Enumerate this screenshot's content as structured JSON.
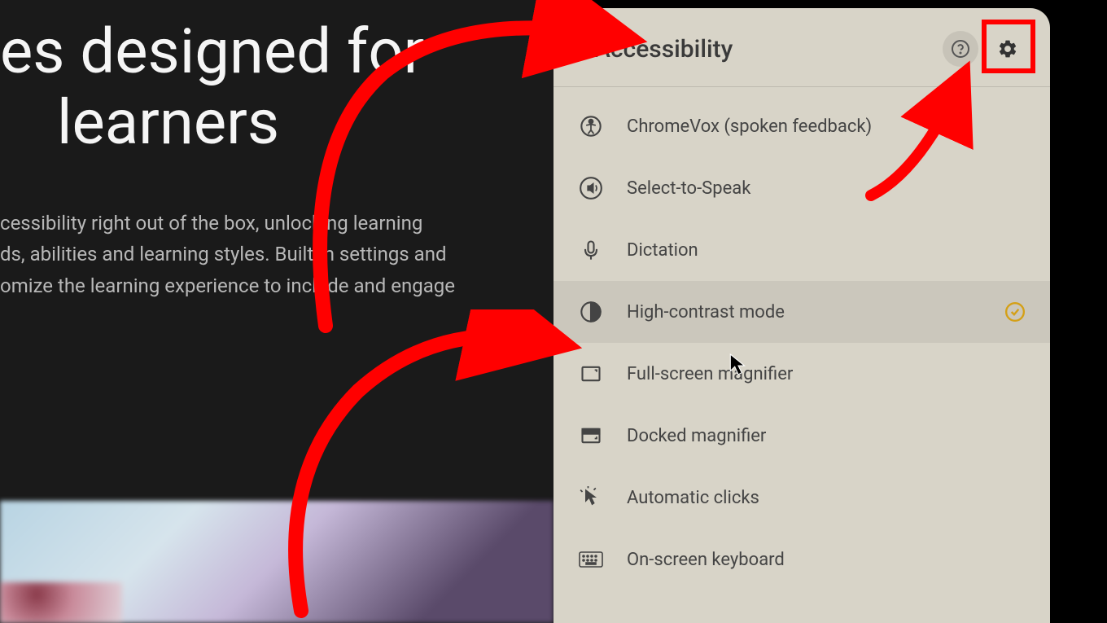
{
  "background": {
    "heading_line1": "es designed for",
    "heading_line2": "learners",
    "body": "cessibility right out of the box, unlocking learning\nds, abilities and learning styles. Built-in settings and\nomize the learning experience to include and engage"
  },
  "panel": {
    "title": "Accessibility",
    "items": [
      {
        "id": "chromevox",
        "label": "ChromeVox (spoken feedback)",
        "icon": "accessibility-icon",
        "highlighted": false,
        "checked": false
      },
      {
        "id": "select-to-speak",
        "label": "Select-to-Speak",
        "icon": "speak-icon",
        "highlighted": false,
        "checked": false
      },
      {
        "id": "dictation",
        "label": "Dictation",
        "icon": "mic-icon",
        "highlighted": false,
        "checked": false
      },
      {
        "id": "high-contrast",
        "label": "High-contrast mode",
        "icon": "contrast-icon",
        "highlighted": true,
        "checked": true
      },
      {
        "id": "full-screen-magnifier",
        "label": "Full-screen magnifier",
        "icon": "fullscreen-icon",
        "highlighted": false,
        "checked": false
      },
      {
        "id": "docked-magnifier",
        "label": "Docked magnifier",
        "icon": "docked-icon",
        "highlighted": false,
        "checked": false
      },
      {
        "id": "automatic-clicks",
        "label": "Automatic clicks",
        "icon": "autoclick-icon",
        "highlighted": false,
        "checked": false
      },
      {
        "id": "on-screen-keyboard",
        "label": "On-screen keyboard",
        "icon": "keyboard-icon",
        "highlighted": false,
        "checked": false
      }
    ]
  },
  "annotations": {
    "highlight_color": "#ff0000"
  }
}
